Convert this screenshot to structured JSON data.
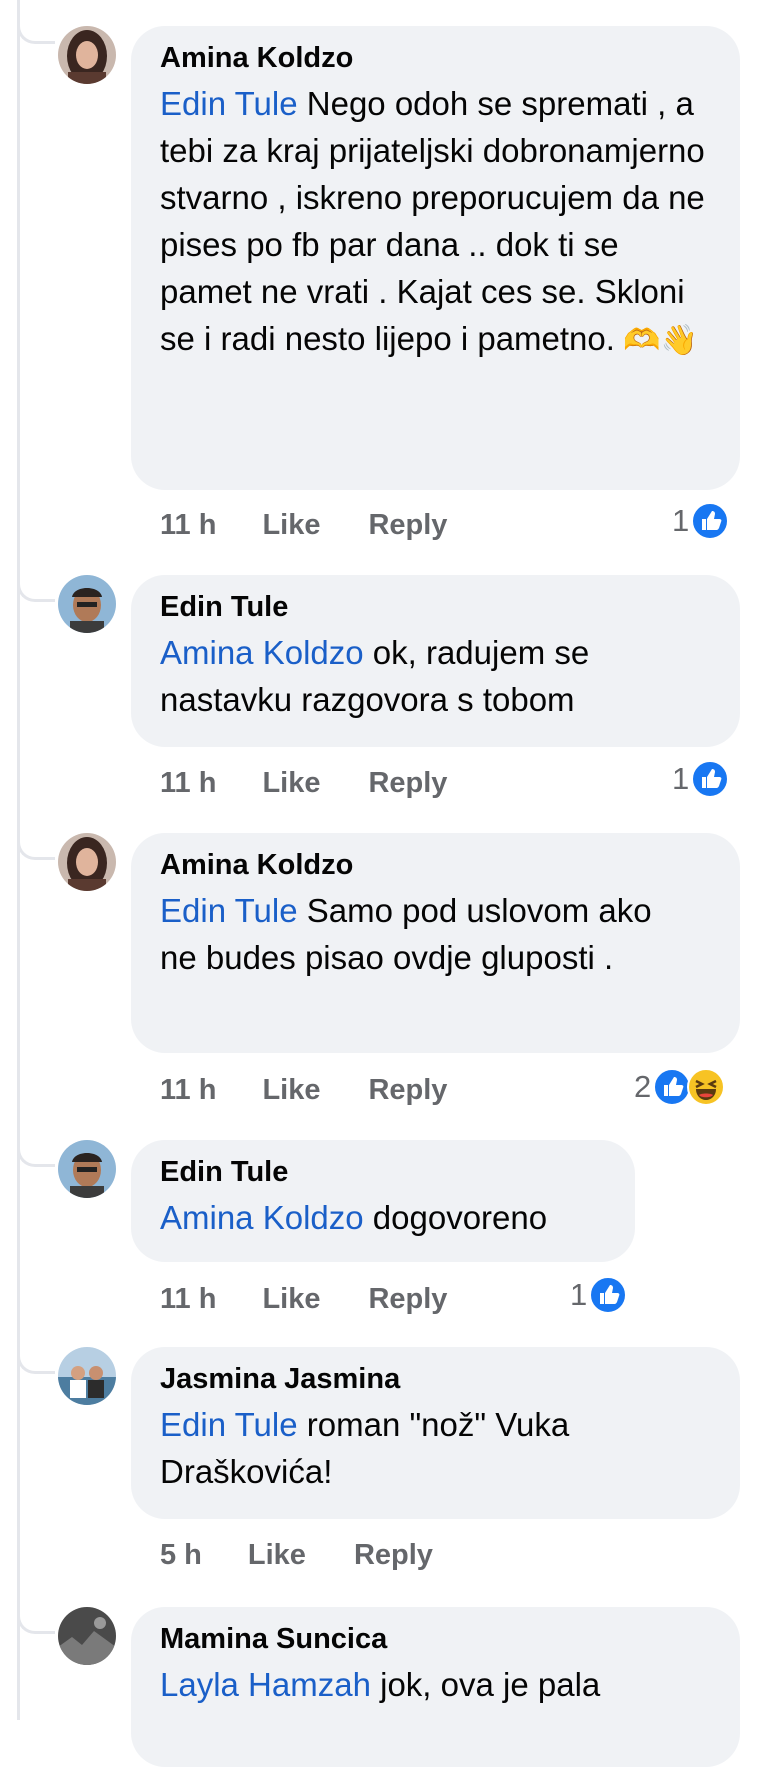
{
  "comments": [
    {
      "author": "Amina Koldzo",
      "mention": "Edin Tule",
      "text": " Nego odoh se spremati , a tebi za kraj prijateljski dobronamjerno stvarno , iskreno preporucujem da ne pises po fb par dana .. dok ti se pamet ne vrati . Kajat ces se. Skloni se i radi nesto lijepo i pametno.",
      "emoji": " 🫶👋",
      "time": "11 h",
      "like": "Like",
      "reply": "Reply",
      "reaction_count": "1",
      "reactions": [
        "like-icon"
      ]
    },
    {
      "author": "Edin Tule",
      "mention": "Amina Koldzo",
      "text": " ok, radujem se nastavku razgovora s tobom",
      "emoji": "",
      "time": "11 h",
      "like": "Like",
      "reply": "Reply",
      "reaction_count": "1",
      "reactions": [
        "like-icon"
      ]
    },
    {
      "author": "Amina Koldzo",
      "mention": "Edin Tule",
      "text": " Samo pod uslovom ako ne budes pisao ovdje gluposti .",
      "emoji": "",
      "time": "11 h",
      "like": "Like",
      "reply": "Reply",
      "reaction_count": "2",
      "reactions": [
        "like-icon",
        "haha-icon"
      ]
    },
    {
      "author": "Edin Tule",
      "mention": "Amina Koldzo",
      "text": " dogovoreno",
      "emoji": "",
      "time": "11 h",
      "like": "Like",
      "reply": "Reply",
      "reaction_count": "1",
      "reactions": [
        "like-icon"
      ]
    },
    {
      "author": "Jasmina Jasmina",
      "mention": "Edin Tule",
      "text": " roman \"nož\"  Vuka Draškovića!",
      "emoji": "",
      "time": "5 h",
      "like": "Like",
      "reply": "Reply"
    },
    {
      "author": "Mamina Suncica",
      "mention": "Layla Hamzah",
      "text": " jok, ova je pala",
      "emoji": ""
    }
  ],
  "colors": {
    "bubble": "#f0f2f5",
    "mention": "#1a5fc8",
    "like_blue": "#1877f2",
    "meta_gray": "#65676b"
  }
}
